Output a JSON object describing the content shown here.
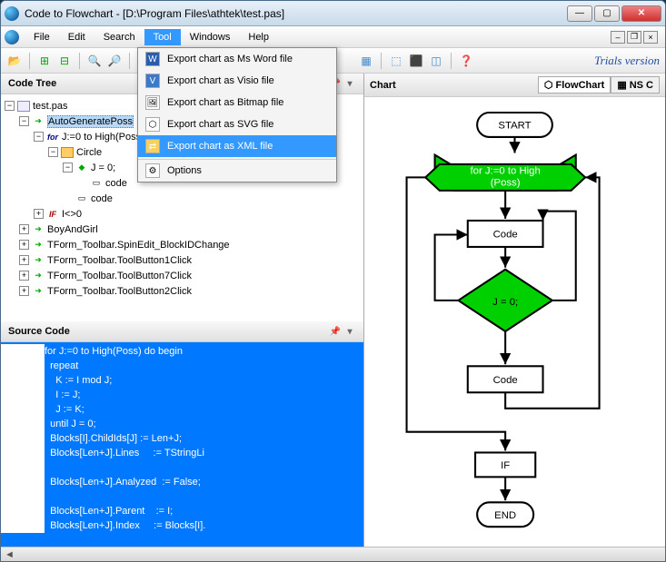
{
  "title": "Code to Flowchart - [D:\\Program Files\\athtek\\test.pas]",
  "menu": {
    "file": "File",
    "edit": "Edit",
    "search": "Search",
    "tool": "Tool",
    "windows": "Windows",
    "help": "Help"
  },
  "toolmenu": {
    "word": "Export chart as Ms Word file",
    "visio": "Export chart as Visio file",
    "bitmap": "Export chart as Bitmap file",
    "svg": "Export chart as SVG file",
    "xml": "Export chart as XML file",
    "options": "Options"
  },
  "trials": "Trials version",
  "panels": {
    "codetree": "Code Tree",
    "sourcecode": "Source Code",
    "chart": "Chart"
  },
  "tabs": {
    "flow": "FlowChart",
    "ns": "NS C"
  },
  "tree": {
    "root": "test.pas",
    "n1": "AutoGeneratePoss",
    "n2": "J:=0 to High(Poss)",
    "n3": "Circle",
    "n4": "J = 0;",
    "n5": "code",
    "n6": "code",
    "n7": "I<>0",
    "n8": "BoyAndGirl",
    "n9": "TForm_Toolbar.SpinEdit_BlockIDChange",
    "n10": "TForm_Toolbar.ToolButton1Click",
    "n11": "TForm_Toolbar.ToolButton7Click",
    "n12": "TForm_Toolbar.ToolButton2Click",
    "for": "for",
    "if": "IF"
  },
  "code": {
    "l1": "for J:=0 to High(Poss) do begin",
    "l2": "  repeat",
    "l3": "    K := I mod J;",
    "l4": "    I := J;",
    "l5": "    J := K;",
    "l6": "  until J = 0;",
    "l7": "  Blocks[I].ChildIds[J] := Len+J;",
    "l8": "  Blocks[Len+J].Lines     := TStringLi",
    "l9": "",
    "l10": "  Blocks[Len+J].Analyzed  := False;",
    "l11": "",
    "l12": "  Blocks[Len+J].Parent    := I;",
    "l13": "  Blocks[Len+J].Index     := Blocks[I]."
  },
  "flow": {
    "start": "START",
    "for": "for J:=0 to High\n(Poss)",
    "code": "Code",
    "cond": "J = 0;",
    "if": "IF",
    "end": "END"
  }
}
